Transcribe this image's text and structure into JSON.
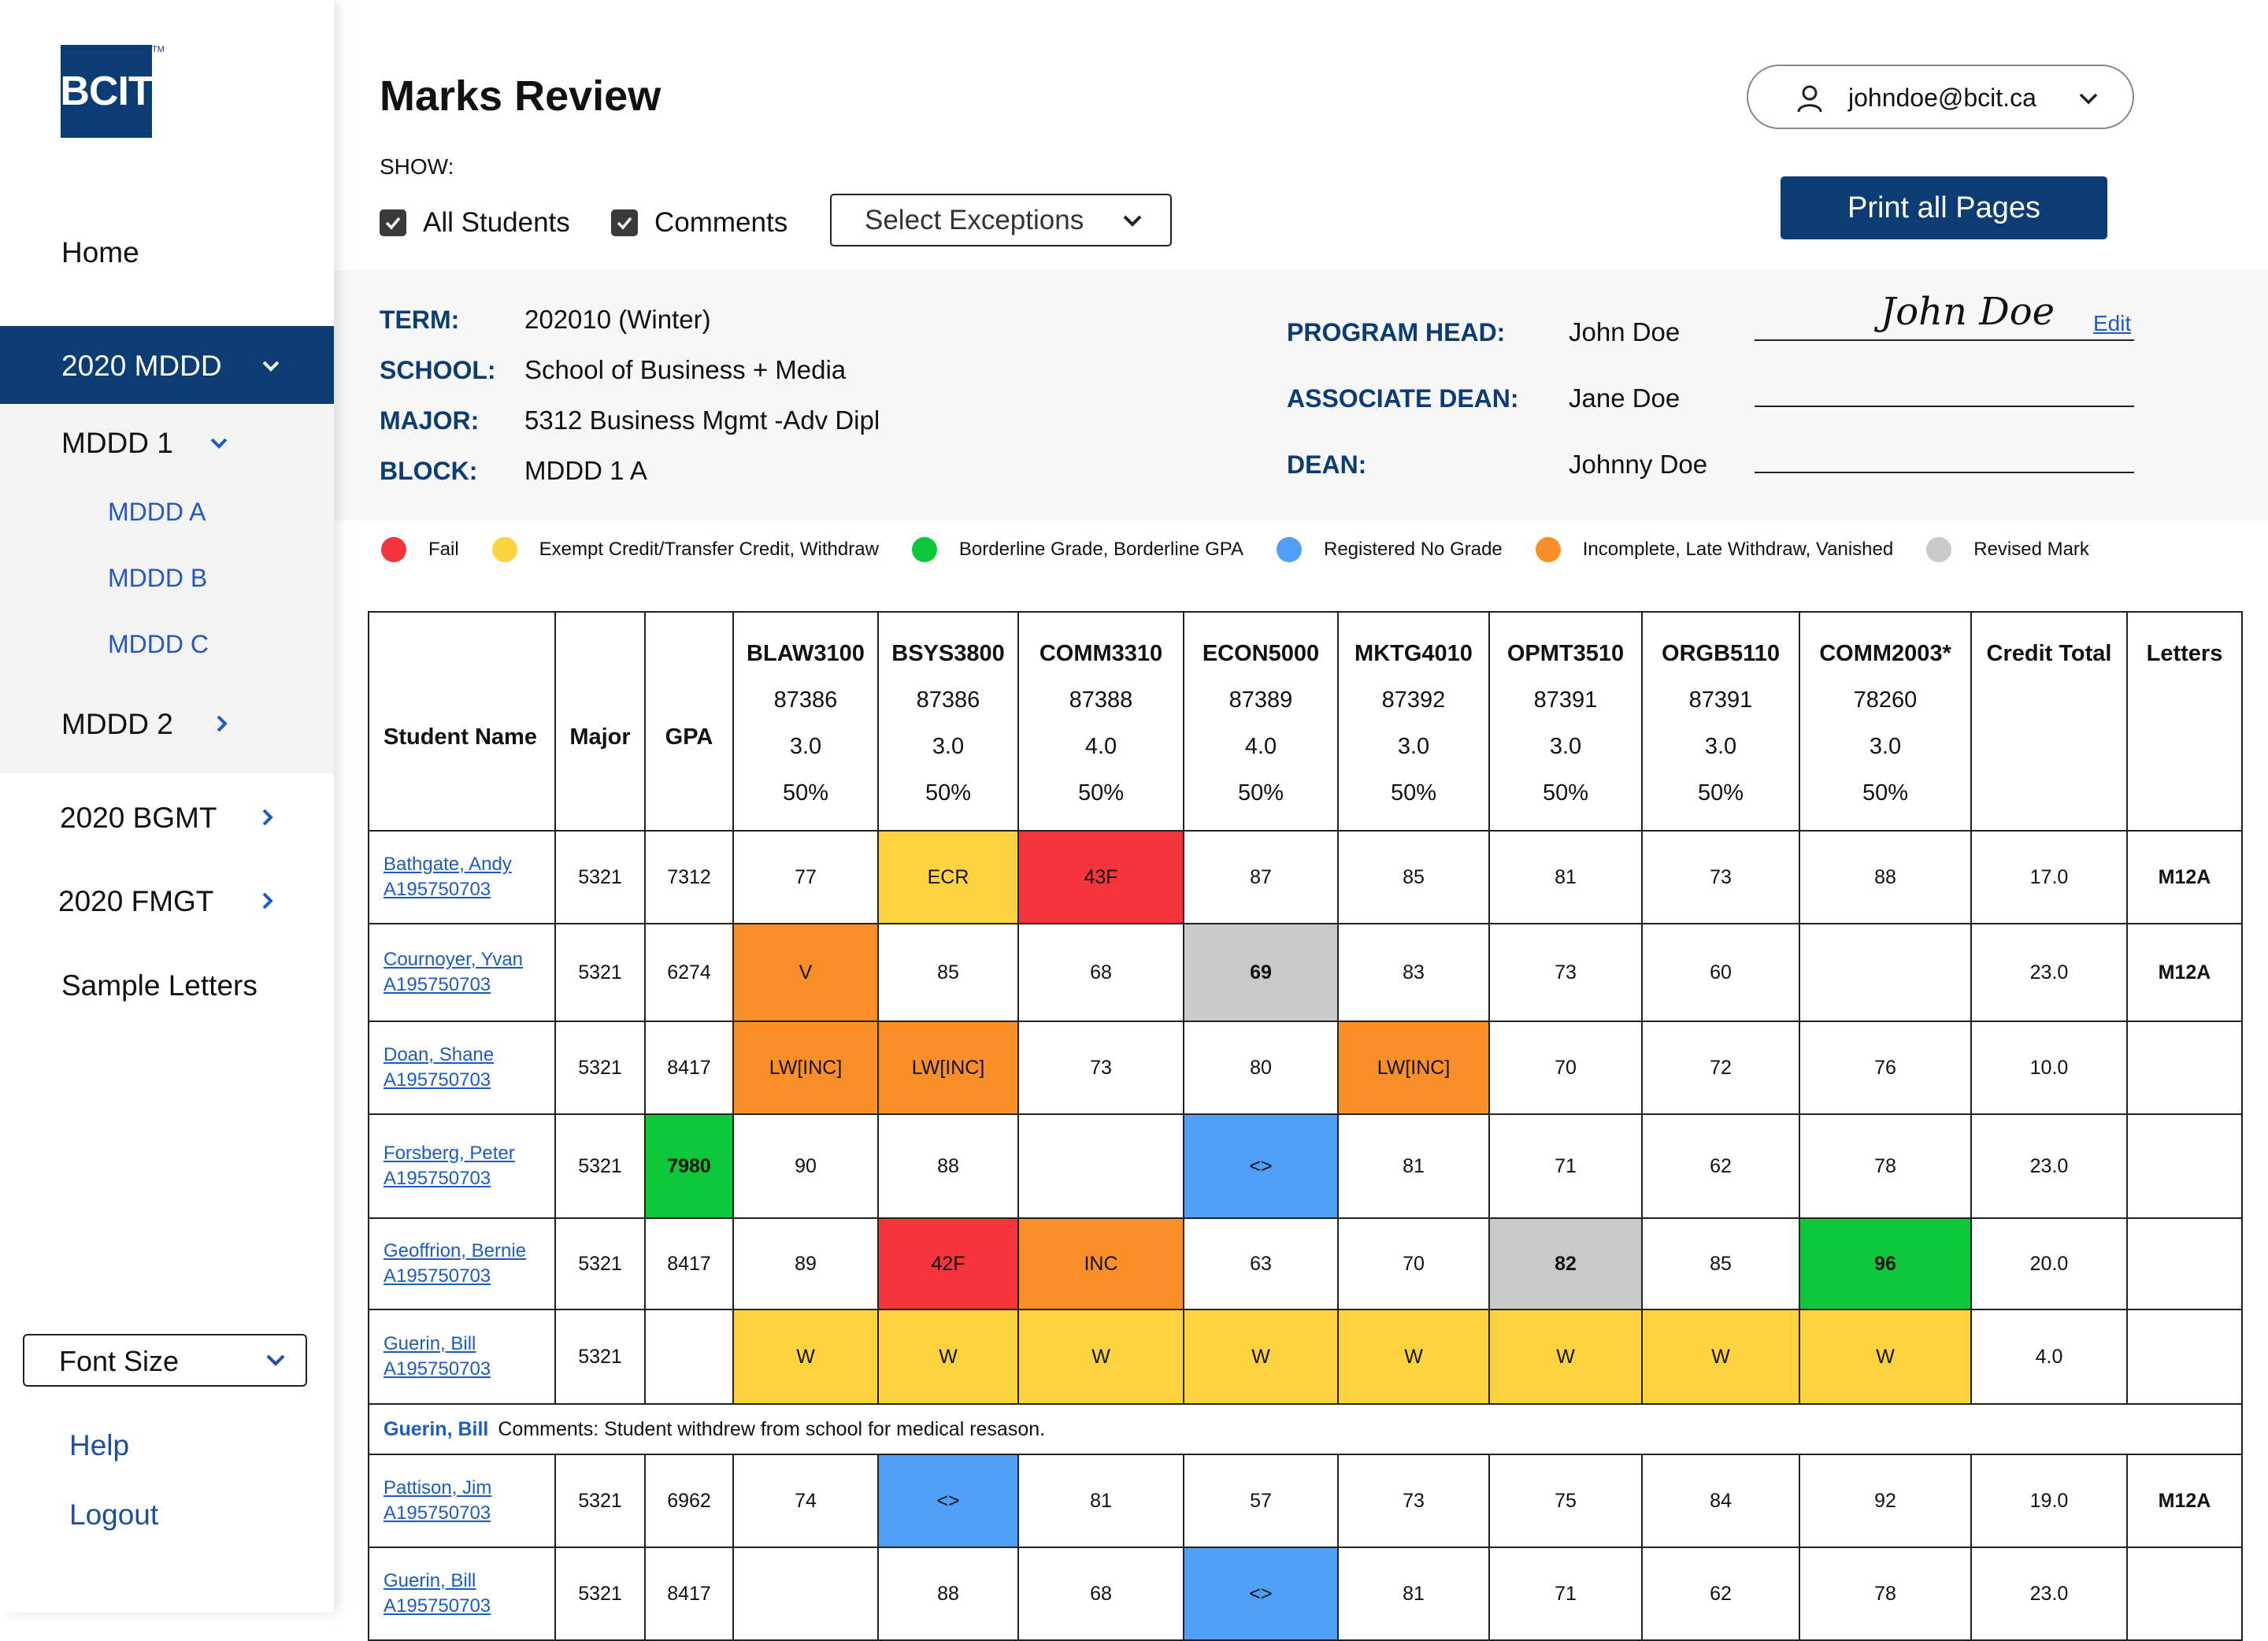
{
  "brand": {
    "logo_text": "BCIT",
    "logo_tm": "TM",
    "brand_color": "#0c3c74"
  },
  "sidebar": {
    "home": "Home",
    "active_program": "2020 MDDD",
    "sub_1": "MDDD 1",
    "sub_1_items": [
      "MDDD A",
      "MDDD B",
      "MDDD C"
    ],
    "sub_2": "MDDD 2",
    "programs": [
      "2020 BGMT",
      "2020 FMGT"
    ],
    "sample_letters": "Sample Letters",
    "font_size": "Font Size",
    "help": "Help",
    "logout": "Logout"
  },
  "header": {
    "title": "Marks Review",
    "show_label": "SHOW:",
    "checkbox_all": "All Students",
    "checkbox_comments": "Comments",
    "select_exceptions": "Select Exceptions",
    "user_email": "johndoe@bcit.ca",
    "print_button": "Print all Pages"
  },
  "info": {
    "term_label": "TERM:",
    "term": "202010 (Winter)",
    "school_label": "SCHOOL:",
    "school": "School of Business + Media",
    "major_label": "MAJOR:",
    "major": "5312 Business Mgmt -Adv Dipl",
    "block_label": "BLOCK:",
    "block": "MDDD 1 A",
    "program_head_label": "PROGRAM HEAD:",
    "program_head": "John Doe",
    "associate_dean_label": "ASSOCIATE DEAN:",
    "associate_dean": "Jane Doe",
    "dean_label": "DEAN:",
    "dean": "Johnny Doe",
    "signature": "John Doe",
    "edit_link": "Edit"
  },
  "legend": [
    {
      "label": "Fail",
      "color": "#f4363c"
    },
    {
      "label": "Exempt Credit/Transfer Credit, Withdraw",
      "color": "#fdd43f"
    },
    {
      "label": "Borderline Grade, Borderline GPA",
      "color": "#0ec83b"
    },
    {
      "label": "Registered No Grade",
      "color": "#4f9ff8"
    },
    {
      "label": "Incomplete, Late Withdraw, Vanished",
      "color": "#fb8f27"
    },
    {
      "label": "Revised Mark",
      "color": "#c9c9c9"
    }
  ],
  "table": {
    "headers": {
      "student_name": "Student Name",
      "major": "Major",
      "gpa": "GPA",
      "credit_total": "Credit Total",
      "letters": "Letters"
    },
    "courses": [
      {
        "code": "BLAW3100",
        "crn": "87386",
        "credits": "3.0",
        "weight": "50%"
      },
      {
        "code": "BSYS3800",
        "crn": "87386",
        "credits": "3.0",
        "weight": "50%"
      },
      {
        "code": "COMM3310",
        "crn": "87388",
        "credits": "4.0",
        "weight": "50%"
      },
      {
        "code": "ECON5000",
        "crn": "87389",
        "credits": "4.0",
        "weight": "50%"
      },
      {
        "code": "MKTG4010",
        "crn": "87392",
        "credits": "3.0",
        "weight": "50%"
      },
      {
        "code": "OPMT3510",
        "crn": "87391",
        "credits": "3.0",
        "weight": "50%"
      },
      {
        "code": "ORGB5110",
        "crn": "87391",
        "credits": "3.0",
        "weight": "50%"
      },
      {
        "code": "COMM2003*",
        "crn": "78260",
        "credits": "3.0",
        "weight": "50%"
      }
    ],
    "rows": [
      {
        "name": "Bathgate, Andy",
        "id": "A195750703",
        "major": "5321",
        "gpa": "7312",
        "gpa_flag": "",
        "marks": [
          [
            "77",
            ""
          ],
          [
            "ECR",
            "yellow"
          ],
          [
            "43F",
            "red"
          ],
          [
            "87",
            ""
          ],
          [
            "85",
            ""
          ],
          [
            "81",
            ""
          ],
          [
            "73",
            ""
          ],
          [
            "88",
            ""
          ]
        ],
        "credit_total": "17.0",
        "letters": "M12A"
      },
      {
        "name": "Cournoyer, Yvan",
        "id": "A195750703",
        "major": "5321",
        "gpa": "6274",
        "gpa_flag": "",
        "marks": [
          [
            "V",
            "orange"
          ],
          [
            "85",
            ""
          ],
          [
            "68",
            ""
          ],
          [
            "69",
            "gray"
          ],
          [
            "83",
            ""
          ],
          [
            "73",
            ""
          ],
          [
            "60",
            ""
          ],
          [
            "",
            ""
          ]
        ],
        "credit_total": "23.0",
        "letters": "M12A"
      },
      {
        "name": "Doan, Shane",
        "id": "A195750703",
        "major": "5321",
        "gpa": "8417",
        "gpa_flag": "",
        "marks": [
          [
            "LW[INC]",
            "orange"
          ],
          [
            "LW[INC]",
            "orange"
          ],
          [
            "73",
            ""
          ],
          [
            "80",
            ""
          ],
          [
            "LW[INC]",
            "orange"
          ],
          [
            "70",
            ""
          ],
          [
            "72",
            ""
          ],
          [
            "76",
            ""
          ]
        ],
        "credit_total": "10.0",
        "letters": ""
      },
      {
        "name": "Forsberg, Peter",
        "id": "A195750703",
        "major": "5321",
        "gpa": "7980",
        "gpa_flag": "green",
        "marks": [
          [
            "90",
            ""
          ],
          [
            "88",
            ""
          ],
          [
            "",
            ""
          ],
          [
            "<>",
            "blue"
          ],
          [
            "81",
            ""
          ],
          [
            "71",
            ""
          ],
          [
            "62",
            ""
          ],
          [
            "78",
            ""
          ]
        ],
        "credit_total": "23.0",
        "letters": ""
      },
      {
        "name": "Geoffrion, Bernie",
        "id": "A195750703",
        "major": "5321",
        "gpa": "8417",
        "gpa_flag": "",
        "marks": [
          [
            "89",
            ""
          ],
          [
            "42F",
            "red"
          ],
          [
            "INC",
            "orange"
          ],
          [
            "63",
            ""
          ],
          [
            "70",
            ""
          ],
          [
            "82",
            "gray"
          ],
          [
            "85",
            ""
          ],
          [
            "96",
            "green"
          ]
        ],
        "credit_total": "20.0",
        "letters": ""
      },
      {
        "name": "Guerin, Bill",
        "id": "A195750703",
        "major": "5321",
        "gpa": "",
        "gpa_flag": "",
        "marks": [
          [
            "W",
            "yellow"
          ],
          [
            "W",
            "yellow"
          ],
          [
            "W",
            "yellow"
          ],
          [
            "W",
            "yellow"
          ],
          [
            "W",
            "yellow"
          ],
          [
            "W",
            "yellow"
          ],
          [
            "W",
            "yellow"
          ],
          [
            "W",
            "yellow"
          ]
        ],
        "credit_total": "4.0",
        "letters": "",
        "comment": {
          "name": "Guerin, Bill",
          "text": "Comments: Student withdrew from school for medical resason."
        }
      },
      {
        "name": "Pattison, Jim",
        "id": "A195750703",
        "major": "5321",
        "gpa": "6962",
        "gpa_flag": "",
        "marks": [
          [
            "74",
            ""
          ],
          [
            "<>",
            "blue"
          ],
          [
            "81",
            ""
          ],
          [
            "57",
            ""
          ],
          [
            "73",
            ""
          ],
          [
            "75",
            ""
          ],
          [
            "84",
            ""
          ],
          [
            "92",
            ""
          ]
        ],
        "credit_total": "19.0",
        "letters": "M12A"
      },
      {
        "name": "Guerin, Bill",
        "id": "A195750703",
        "major": "5321",
        "gpa": "8417",
        "gpa_flag": "",
        "marks": [
          [
            "",
            ""
          ],
          [
            "88",
            ""
          ],
          [
            "68",
            ""
          ],
          [
            "<>",
            "blue"
          ],
          [
            "81",
            ""
          ],
          [
            "71",
            ""
          ],
          [
            "62",
            ""
          ],
          [
            "78",
            ""
          ]
        ],
        "credit_total": "23.0",
        "letters": ""
      }
    ]
  }
}
